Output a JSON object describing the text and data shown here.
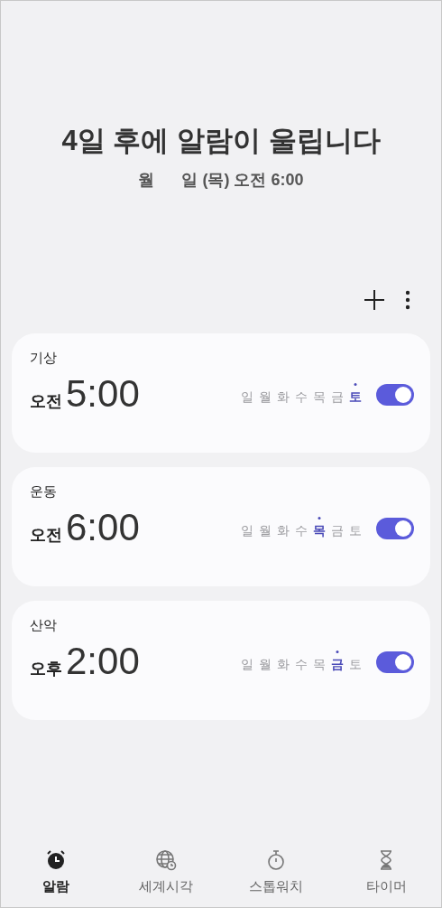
{
  "header": {
    "title": "4일 후에 알람이 울립니다",
    "date_parts": [
      "월",
      "일 (목) 오전 6:00"
    ]
  },
  "alarms": [
    {
      "label": "기상",
      "period": "오전",
      "time": "5:00",
      "on": true,
      "days": [
        {
          "label": "일",
          "selected": false
        },
        {
          "label": "월",
          "selected": false
        },
        {
          "label": "화",
          "selected": false
        },
        {
          "label": "수",
          "selected": false
        },
        {
          "label": "목",
          "selected": false
        },
        {
          "label": "금",
          "selected": false
        },
        {
          "label": "토",
          "selected": true
        }
      ]
    },
    {
      "label": "운동",
      "period": "오전",
      "time": "6:00",
      "on": true,
      "days": [
        {
          "label": "일",
          "selected": false
        },
        {
          "label": "월",
          "selected": false
        },
        {
          "label": "화",
          "selected": false
        },
        {
          "label": "수",
          "selected": false
        },
        {
          "label": "목",
          "selected": true
        },
        {
          "label": "금",
          "selected": false
        },
        {
          "label": "토",
          "selected": false
        }
      ]
    },
    {
      "label": "산악",
      "period": "오후",
      "time": "2:00",
      "on": true,
      "days": [
        {
          "label": "일",
          "selected": false
        },
        {
          "label": "월",
          "selected": false
        },
        {
          "label": "화",
          "selected": false
        },
        {
          "label": "수",
          "selected": false
        },
        {
          "label": "목",
          "selected": false
        },
        {
          "label": "금",
          "selected": true
        },
        {
          "label": "토",
          "selected": false
        }
      ]
    }
  ],
  "nav": [
    {
      "label": "알람",
      "kind": "alarm",
      "selected": true
    },
    {
      "label": "세계시각",
      "kind": "globe",
      "selected": false
    },
    {
      "label": "스톱워치",
      "kind": "stopwatch",
      "selected": false
    },
    {
      "label": "타이머",
      "kind": "timer",
      "selected": false
    }
  ]
}
